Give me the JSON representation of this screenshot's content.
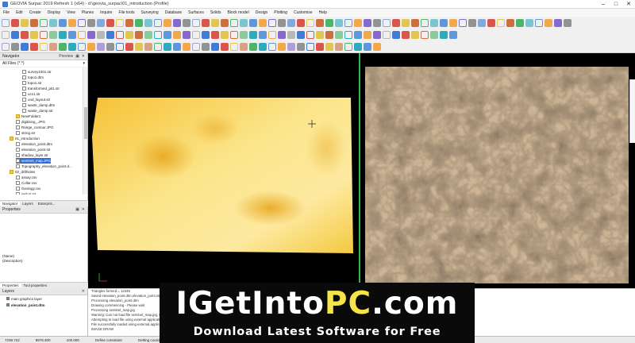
{
  "window": {
    "title": "GEOVIA Surpac 2019 Refresh 1 (x64) - d:\\geovia_surpac\\01_introduction (Profile)"
  },
  "menu": [
    "File",
    "Edit",
    "Create",
    "Display",
    "View",
    "Planes",
    "Inquire",
    "File tools",
    "Surveying",
    "Database",
    "Surfaces",
    "Solids",
    "Block model",
    "Design",
    "Plotting",
    "Customise",
    "Help"
  ],
  "navigator": {
    "title": "Navigator",
    "preview_label": "Preview",
    "filter": "All Files (*.*)",
    "tree": [
      {
        "label": "survey1001.str",
        "indent": 3,
        "type": "file"
      },
      {
        "label": "topo1.dtm",
        "indent": 3,
        "type": "file"
      },
      {
        "label": "topo1.str",
        "indent": 3,
        "type": "file"
      },
      {
        "label": "transformed_pit1.str",
        "indent": 3,
        "type": "file"
      },
      {
        "label": "ucs1.str",
        "indent": 3,
        "type": "file"
      },
      {
        "label": "und_layout.str",
        "indent": 3,
        "type": "file"
      },
      {
        "label": "waste_dump.dtm",
        "indent": 3,
        "type": "file"
      },
      {
        "label": "waste_dump.str",
        "indent": 3,
        "type": "file"
      },
      {
        "label": "NewFolder1",
        "indent": 2,
        "type": "folder"
      },
      {
        "label": "digitising_.JPG",
        "indent": 2,
        "type": "file"
      },
      {
        "label": "Range_contour.JPG",
        "indent": 2,
        "type": "file"
      },
      {
        "label": "string.str",
        "indent": 2,
        "type": "file"
      },
      {
        "label": "01_introduction",
        "indent": 1,
        "type": "folder"
      },
      {
        "label": "elevation_point.dtm",
        "indent": 2,
        "type": "file"
      },
      {
        "label": "elevation_point.str",
        "indent": 2,
        "type": "file"
      },
      {
        "label": "shadow_layer.str",
        "indent": 2,
        "type": "file"
      },
      {
        "label": "sentinel_map.JPG",
        "indent": 2,
        "type": "file",
        "selected": true
      },
      {
        "label": "Topography_elevation_point.d...",
        "indent": 2,
        "type": "file"
      },
      {
        "label": "02_drillholes",
        "indent": 1,
        "type": "folder"
      },
      {
        "label": "assay.csv",
        "indent": 2,
        "type": "file"
      },
      {
        "label": "Collar.csv",
        "indent": 2,
        "type": "file"
      },
      {
        "label": "Geology.csv",
        "indent": 2,
        "type": "file"
      },
      {
        "label": "redcol.txt",
        "indent": 2,
        "type": "file"
      }
    ],
    "tabs": [
      "Navigator",
      "Layers",
      "Enterpris..."
    ]
  },
  "properties": {
    "title": "Properties",
    "name_label": "(Name)",
    "description_label": "(Description)",
    "tabs": [
      "Properties",
      "Tool properties"
    ]
  },
  "layers": {
    "title": "Layers",
    "items": [
      {
        "label": "main graphics layer",
        "checked": true,
        "bold": false
      },
      {
        "label": "elevation_point.dtm",
        "checked": true,
        "bold": true
      }
    ]
  },
  "output": {
    "lines": [
      "Triangles formed = 12345",
      "Saved elevation_point.dtm,elevation_point.str",
      "Processing elevation_point.dtm",
      "Drawing commencing - Please wait",
      "Processing sentinel_map.jpg",
      "Warning: Can not load file sentinel_map.jpg, trying ...",
      "Attempting to load file using external application",
      "File successfully loaded using external application",
      "IMAGE DRAW"
    ]
  },
  "status": {
    "cells": [
      "7238.722",
      "9978.300",
      "100.000",
      "Define constraint",
      "Getting coordinates"
    ]
  },
  "watermark": {
    "line1_prefix": "IGetInto",
    "line1_highlight": "PC",
    "line1_suffix": ".com",
    "line2": "Download Latest Software for Free"
  },
  "colors": {
    "accent_green": "#2fb84a",
    "selection_blue": "#2f6fd6",
    "watermark_yellow": "#f4e34a"
  }
}
